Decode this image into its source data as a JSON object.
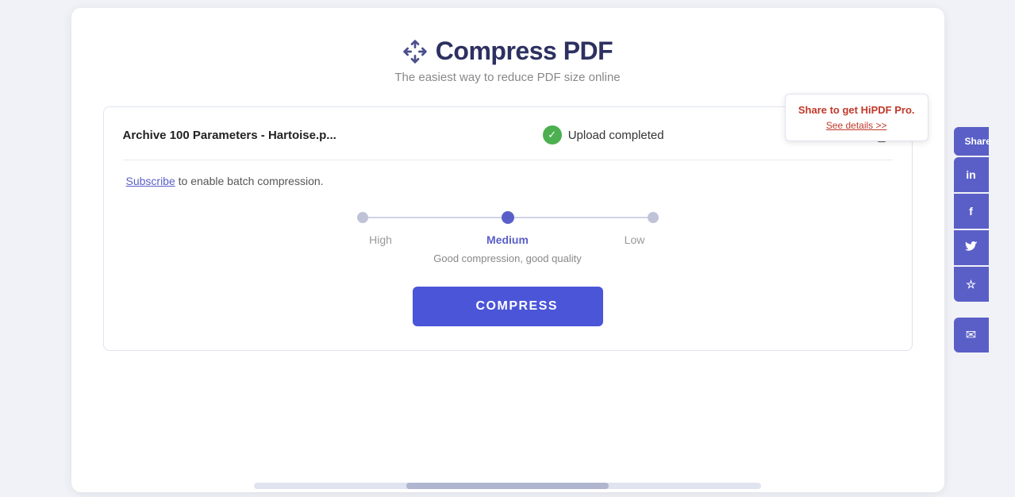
{
  "page": {
    "title": "Compress PDF",
    "subtitle": "The easiest way to reduce PDF size online",
    "background_color": "#e8eaf0"
  },
  "file": {
    "name": "Archive 100 Parameters - Hartoise.p...",
    "upload_status": "Upload completed"
  },
  "batch": {
    "subscribe_label": "Subscribe",
    "notice": " to enable batch compression."
  },
  "compression": {
    "levels": [
      {
        "label": "High",
        "value": "high",
        "active": false
      },
      {
        "label": "Medium",
        "value": "medium",
        "active": true
      },
      {
        "label": "Low",
        "value": "low",
        "active": false
      }
    ],
    "description": "Good compression, good quality"
  },
  "compress_button": {
    "label": "COMPRESS"
  },
  "share": {
    "label": "Share",
    "linkedin_label": "in",
    "facebook_label": "f",
    "twitter_label": "t",
    "star_label": "☆",
    "email_label": "✉"
  },
  "promo": {
    "title": "Share to get HiPDF Pro.",
    "link_label": "See details >>"
  },
  "scrollbar": {}
}
